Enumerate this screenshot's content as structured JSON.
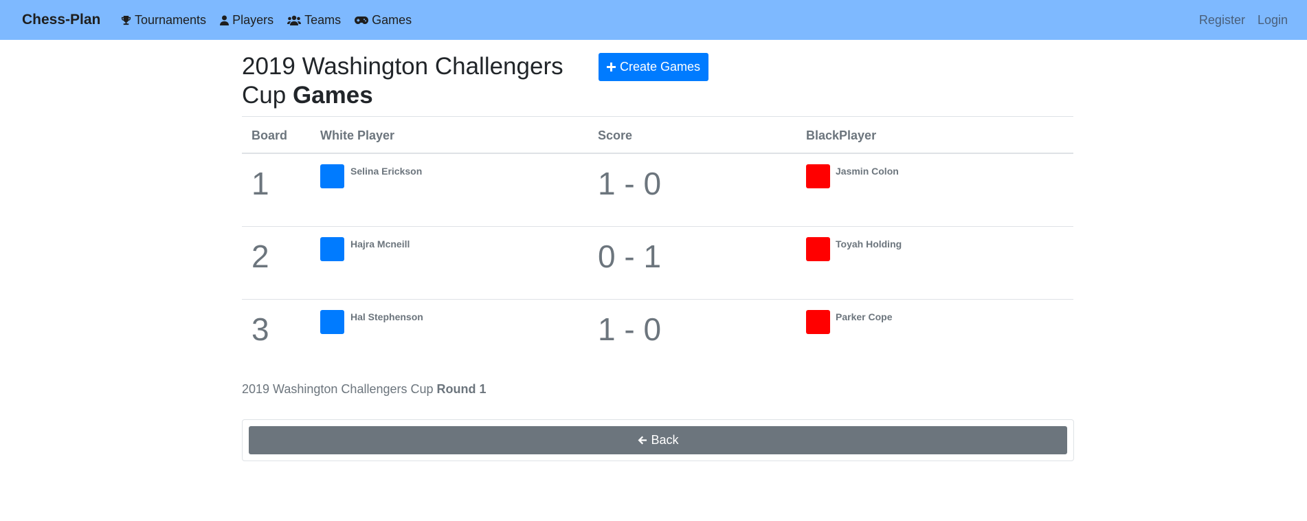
{
  "navbar": {
    "brand": "Chess-Plan",
    "links": [
      {
        "label": "Tournaments",
        "icon": "trophy-icon"
      },
      {
        "label": "Players",
        "icon": "user-icon"
      },
      {
        "label": "Teams",
        "icon": "users-icon"
      },
      {
        "label": "Games",
        "icon": "gamepad-icon"
      }
    ],
    "register": "Register",
    "login": "Login"
  },
  "header": {
    "title_prefix": "2019 Washington Challengers Cup",
    "title_bold": "Games",
    "create_button": "Create Games"
  },
  "table": {
    "headers": [
      "Board",
      "White Player",
      "Score",
      "BlackPlayer"
    ],
    "rows": [
      {
        "board": "1",
        "white": "Selina Erickson",
        "score": "1 - 0",
        "black": "Jasmin Colon"
      },
      {
        "board": "2",
        "white": "Hajra Mcneill",
        "score": "0 - 1",
        "black": "Toyah Holding"
      },
      {
        "board": "3",
        "white": "Hal Stephenson",
        "score": "1 - 0",
        "black": "Parker Cope"
      }
    ]
  },
  "round_info": {
    "tournament": "2019 Washington Challengers Cup",
    "round": "Round 1"
  },
  "back_button": "Back",
  "colors": {
    "navbar": "#7eb9ff",
    "primary": "#007bff",
    "white_swatch": "#007bff",
    "black_swatch": "#ff0000",
    "secondary": "#6c757d"
  }
}
